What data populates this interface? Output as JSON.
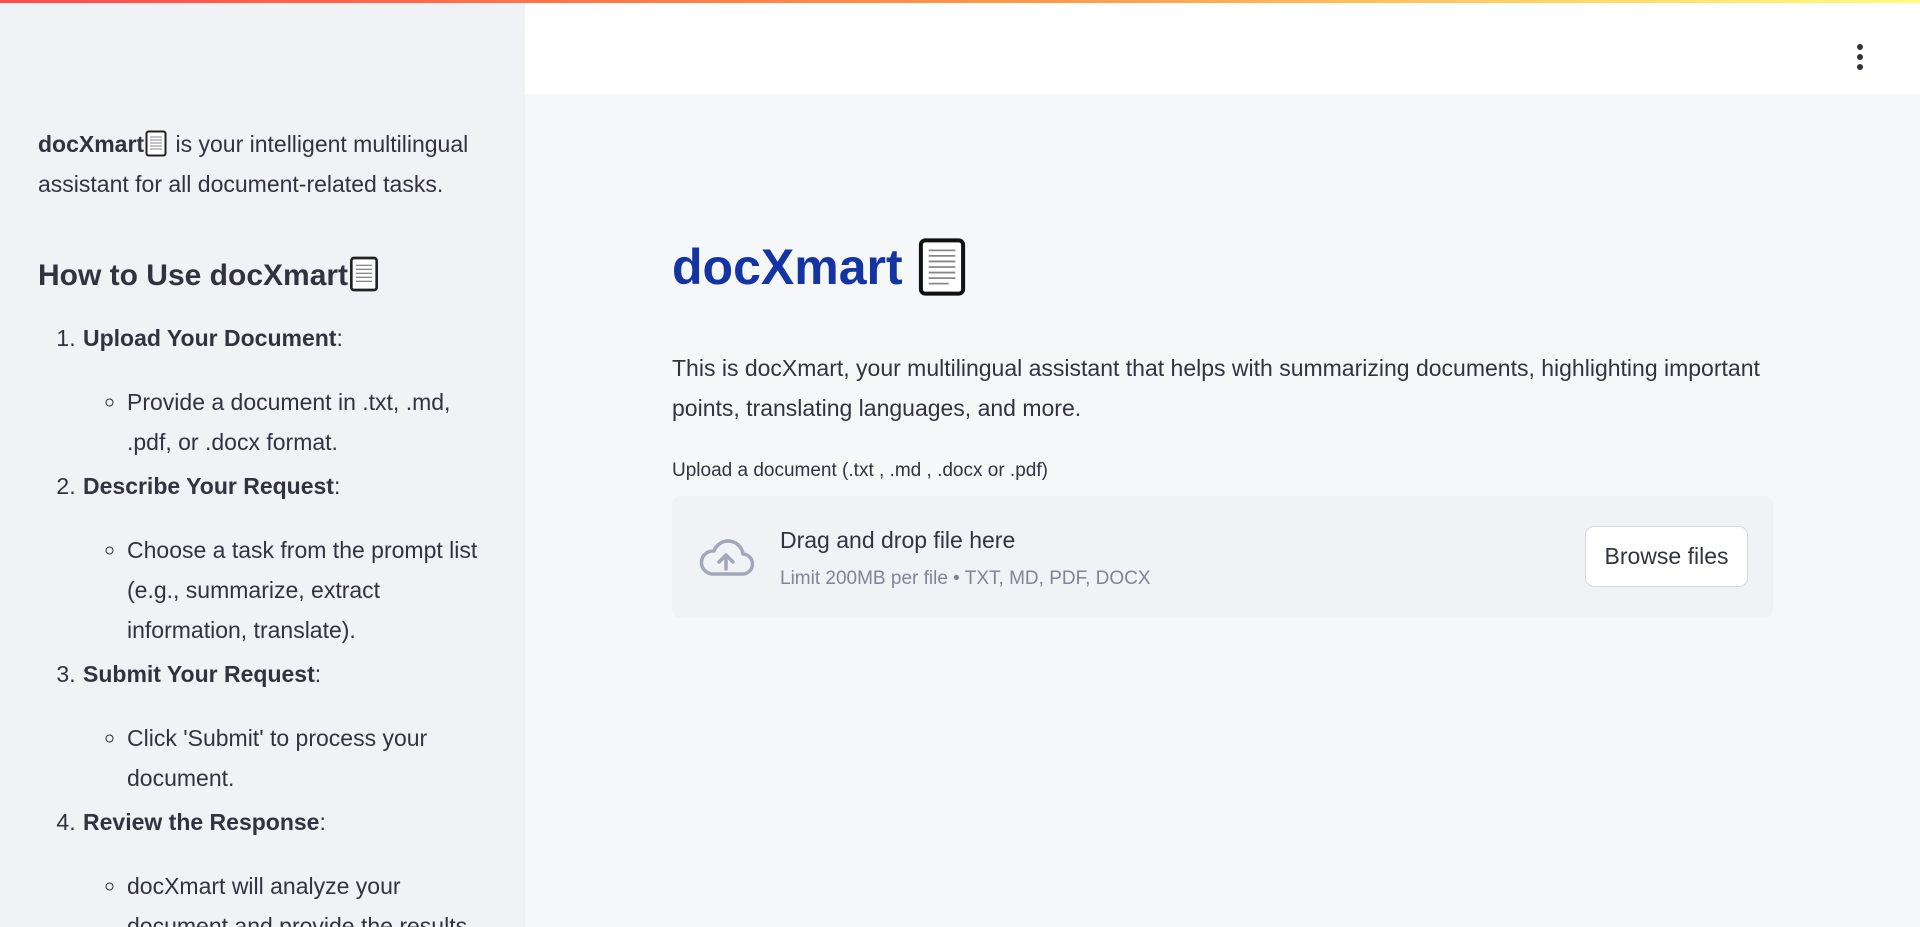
{
  "app": {
    "name": "docXmart",
    "title_emoji": "📃"
  },
  "sidebar": {
    "intro_brand": "docXmart",
    "intro_text": " is your intelligent multilingual assistant for all document-related tasks.",
    "how_title": "How to Use docXmart",
    "steps": [
      {
        "number": "1.",
        "title": "Upload Your Document",
        "detail": "Provide a document in .txt, .md, .pdf, or .docx format."
      },
      {
        "number": "2.",
        "title": "Describe Your Request",
        "detail": "Choose a task from the prompt list (e.g., summarize, extract information, translate)."
      },
      {
        "number": "3.",
        "title": "Submit Your Request",
        "detail": "Click 'Submit' to process your document."
      },
      {
        "number": "4.",
        "title": "Review the Response",
        "detail": "docXmart will analyze your document and provide the results."
      }
    ]
  },
  "header": {
    "menu_icon": "vertical-ellipsis-icon"
  },
  "main": {
    "title": "docXmart",
    "description": "This is docXmart, your multilingual assistant that helps with summarizing documents, highlighting important points, translating languages, and more.",
    "uploader": {
      "label": "Upload a document (.txt , .md , .docx or .pdf)",
      "drop_text": "Drag and drop file here",
      "limit_text": "Limit 200MB per file • TXT, MD, PDF, DOCX",
      "browse_label": "Browse files",
      "icon": "cloud-upload-icon"
    }
  },
  "colors": {
    "title": "#1434a4",
    "sidebar_bg": "#f0f2f6",
    "main_bg": "#f6f7f9",
    "text": "#31333f",
    "muted": "#808495"
  }
}
